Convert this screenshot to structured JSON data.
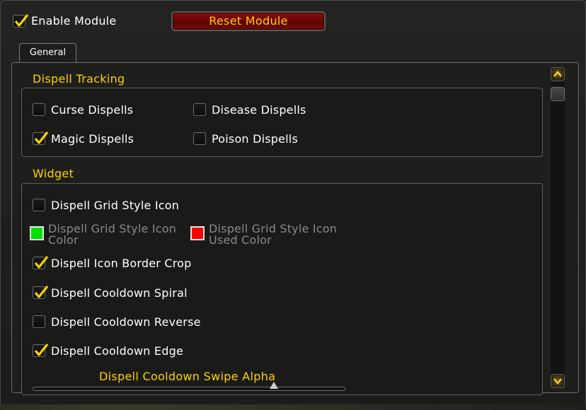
{
  "header": {
    "enable_module_label": "Enable Module",
    "enable_module_checked": true,
    "reset_button_label": "Reset Module"
  },
  "tabs": [
    {
      "label": "General",
      "selected": true
    }
  ],
  "dispell_tracking": {
    "title": "Dispell Tracking",
    "options": [
      {
        "label": "Curse Dispells",
        "checked": false
      },
      {
        "label": "Disease Dispells",
        "checked": false
      },
      {
        "label": "Magic Dispells",
        "checked": true
      },
      {
        "label": "Poison Dispells",
        "checked": false
      }
    ]
  },
  "widget": {
    "title": "Widget",
    "grid_style_icon": {
      "label": "Dispell Grid Style Icon",
      "checked": false
    },
    "grid_icon_color": {
      "label": "Dispell Grid Style Icon Color",
      "color": "#00e000",
      "enabled": false
    },
    "grid_icon_used_color": {
      "label": "Dispell Grid Style Icon Used Color",
      "color": "#ff0000",
      "enabled": false
    },
    "icon_border_crop": {
      "label": "Dispell Icon Border Crop",
      "checked": true
    },
    "cooldown_spiral": {
      "label": "Dispell Cooldown Spiral",
      "checked": true
    },
    "cooldown_reverse": {
      "label": "Dispell Cooldown Reverse",
      "checked": false
    },
    "cooldown_edge": {
      "label": "Dispell Cooldown Edge",
      "checked": true
    },
    "swipe_alpha": {
      "label": "Dispell Cooldown Swipe Alpha"
    }
  },
  "colors": {
    "accent_gold": "#ffd200",
    "button_red": "#7a0a08",
    "disabled_text": "#8a8a8a"
  }
}
